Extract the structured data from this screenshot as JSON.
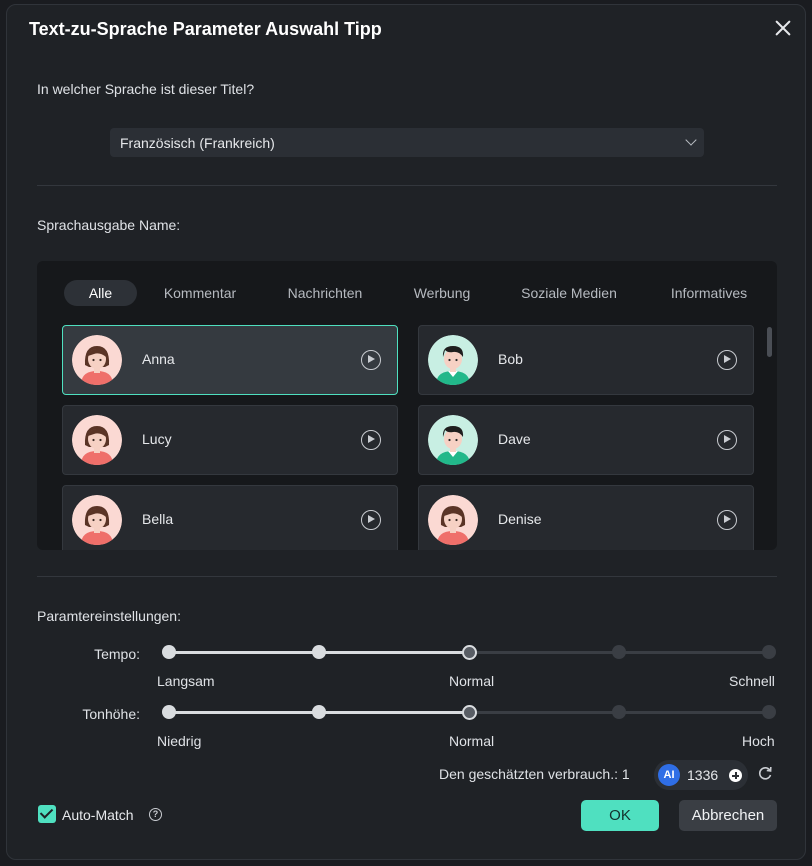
{
  "dialog": {
    "title": "Text-zu-Sprache Parameter Auswahl Tipp",
    "close_icon": "close-icon"
  },
  "language": {
    "question": "In welcher Sprache ist dieser Titel?",
    "selected": "Französisch (Frankreich)"
  },
  "voice": {
    "label": "Sprachausgabe Name:",
    "tabs": [
      {
        "label": "Alle",
        "active": true
      },
      {
        "label": "Kommentar",
        "active": false
      },
      {
        "label": "Nachrichten",
        "active": false
      },
      {
        "label": "Werbung",
        "active": false
      },
      {
        "label": "Soziale Medien",
        "active": false
      },
      {
        "label": "Informatives",
        "active": false
      }
    ],
    "voices": [
      {
        "name": "Anna",
        "gender": "female",
        "selected": true
      },
      {
        "name": "Bob",
        "gender": "male",
        "selected": false
      },
      {
        "name": "Lucy",
        "gender": "female",
        "selected": false
      },
      {
        "name": "Dave",
        "gender": "male",
        "selected": false
      },
      {
        "name": "Bella",
        "gender": "female",
        "selected": false
      },
      {
        "name": "Denise",
        "gender": "female",
        "selected": false
      }
    ]
  },
  "params": {
    "label": "Paramtereinstellungen:",
    "tempo": {
      "label": "Tempo:",
      "steps": 5,
      "value_index": 2,
      "min_label": "Langsam",
      "mid_label": "Normal",
      "max_label": "Schnell"
    },
    "pitch": {
      "label": "Tonhöhe:",
      "steps": 5,
      "value_index": 2,
      "min_label": "Niedrig",
      "mid_label": "Normal",
      "max_label": "Hoch"
    }
  },
  "usage": {
    "label": "Den geschätzten verbrauch.: 1",
    "credits": "1336",
    "ai_badge": "AI"
  },
  "footer": {
    "automatch_label": "Auto-Match",
    "automatch_checked": true,
    "help_glyph": "?",
    "ok_label": "OK",
    "cancel_label": "Abbrechen"
  },
  "colors": {
    "accent": "#4fe0c0",
    "background": "#1f2226"
  }
}
